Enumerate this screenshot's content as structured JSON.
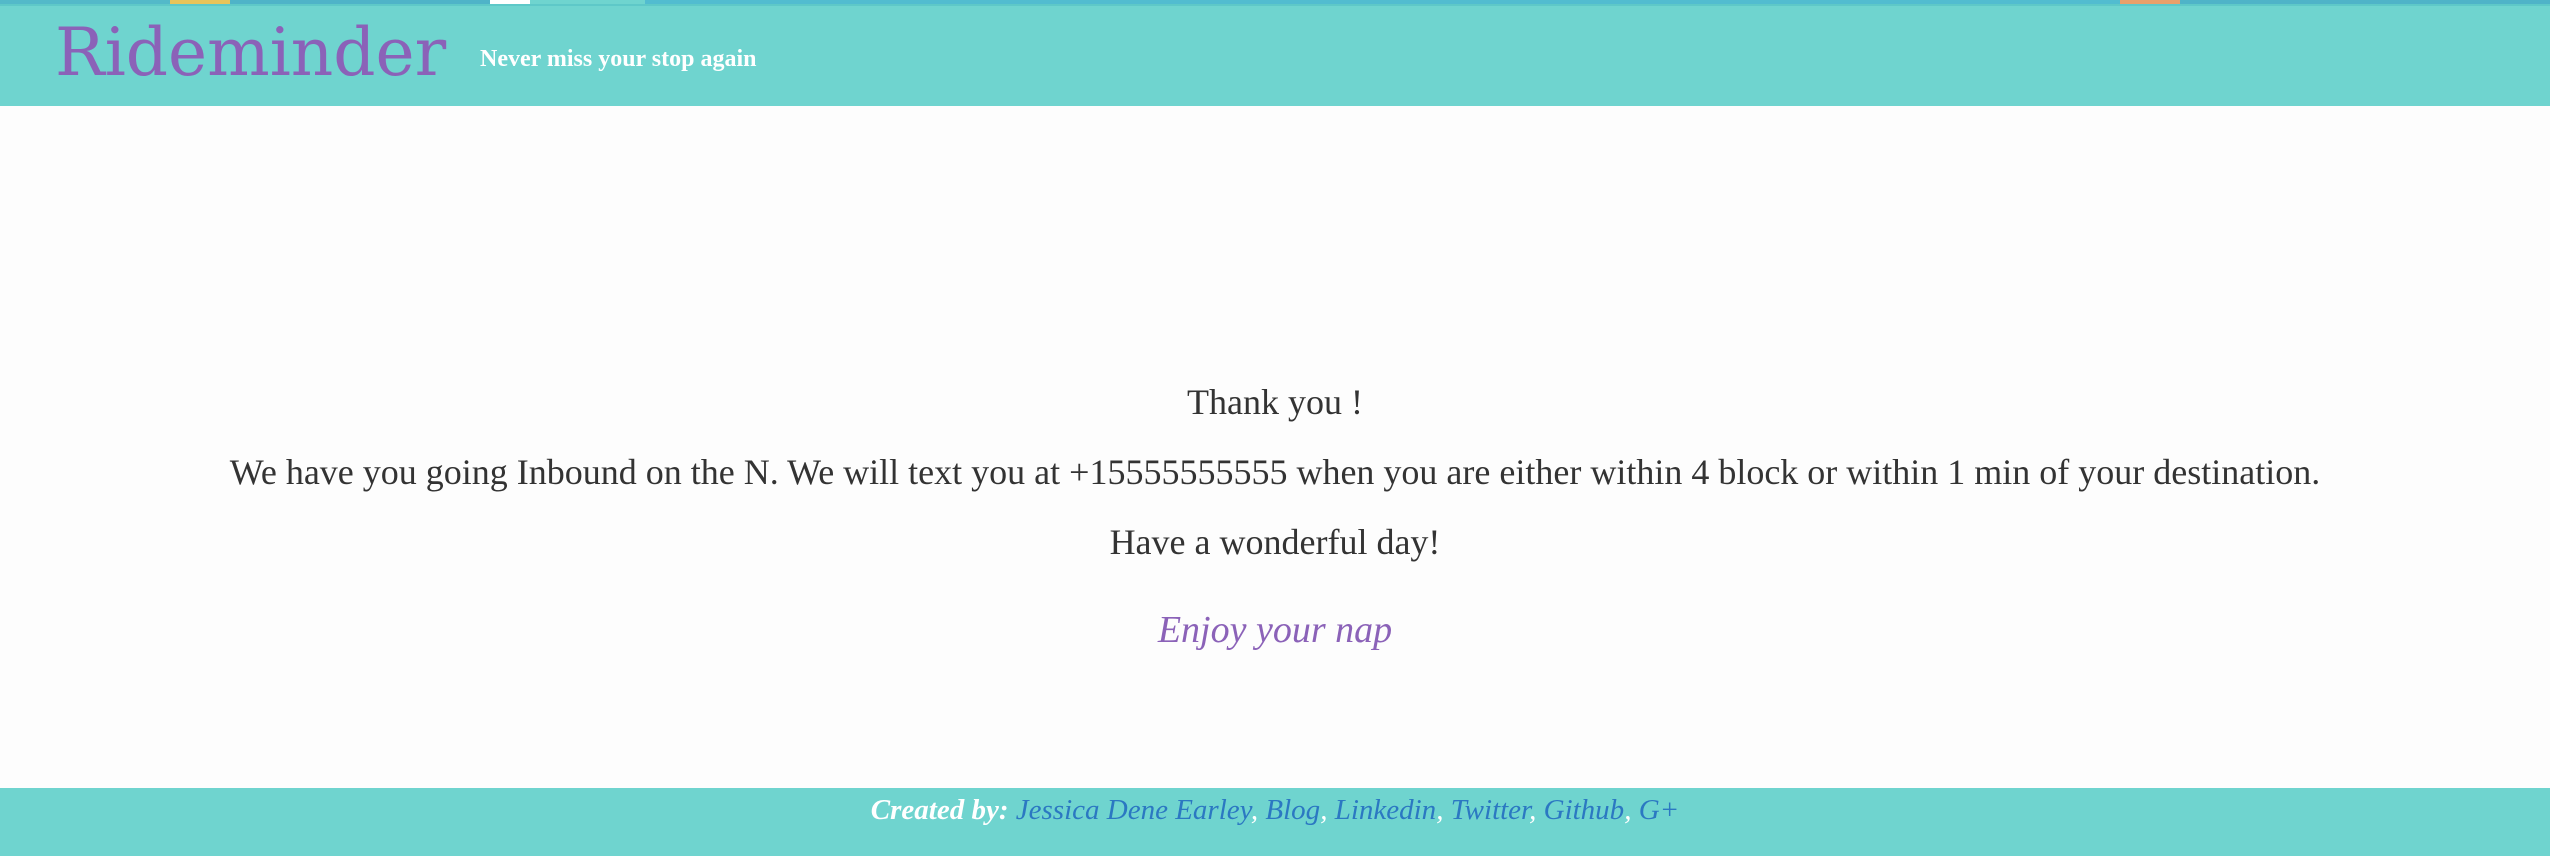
{
  "header": {
    "brand": "Rideminder",
    "tagline": "Never miss your stop again"
  },
  "confirmation": {
    "thanks": "Thank you !",
    "details": "We have you going Inbound on the N. We will text you at +15555555555 when you are either within 4 block or within 1 min of your destination.",
    "closing": "Have a wonderful day!",
    "nap_link": "Enjoy your nap"
  },
  "footer": {
    "label": "Created by:",
    "separator": ",",
    "links": [
      "Jessica Dene Earley",
      "Blog",
      "Linkedin",
      "Twitter",
      "Github",
      "G+"
    ]
  },
  "colors": {
    "header_bg": "#6fd4cf",
    "brand": "#8b62b8",
    "link": "#2b78c2",
    "text": "#333333"
  }
}
